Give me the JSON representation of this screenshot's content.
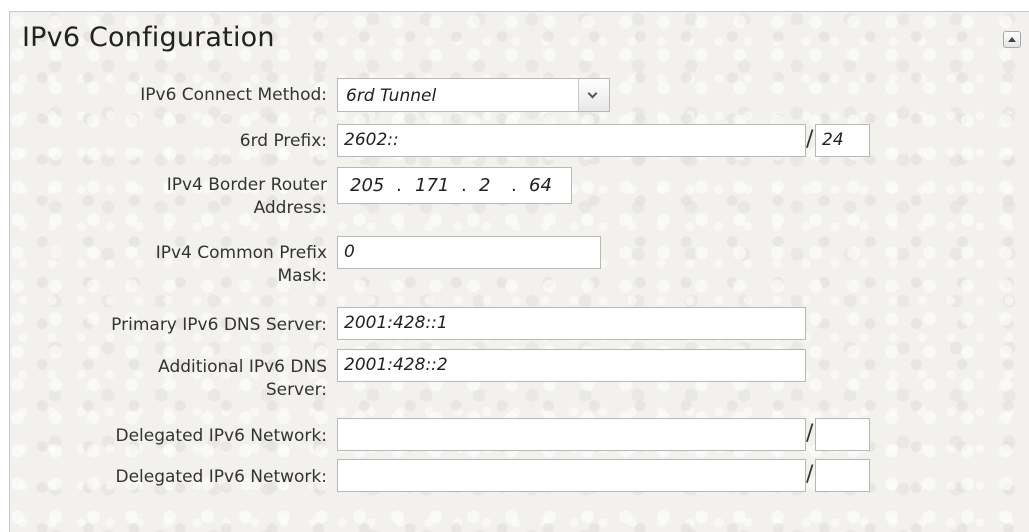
{
  "section": {
    "title": "IPv6 Configuration"
  },
  "icons": {
    "collapse": "collapse-up-icon",
    "dropdown": "chevron-down-icon"
  },
  "fields": {
    "connect_method": {
      "label": "IPv6 Connect Method:",
      "value": "6rd Tunnel"
    },
    "sixrd_prefix": {
      "label": "6rd Prefix:",
      "value": "2602::",
      "separator": "/",
      "length": "24"
    },
    "border_router": {
      "label_line1": "IPv4 Border Router",
      "label_line2": "Address:",
      "octets": [
        "205",
        "171",
        "2",
        "64"
      ],
      "dot": "."
    },
    "common_prefix_mask": {
      "label_line1": "IPv4 Common Prefix",
      "label_line2": "Mask:",
      "value": "0"
    },
    "primary_dns": {
      "label": "Primary IPv6 DNS Server:",
      "value": "2001:428::1"
    },
    "additional_dns": {
      "label_line1": "Additional IPv6 DNS",
      "label_line2": "Server:",
      "value": "2001:428::2"
    },
    "delegated_1": {
      "label": "Delegated IPv6 Network:",
      "value": "",
      "separator": "/",
      "length": ""
    },
    "delegated_2": {
      "label": "Delegated IPv6 Network:",
      "value": "",
      "separator": "/",
      "length": ""
    }
  }
}
